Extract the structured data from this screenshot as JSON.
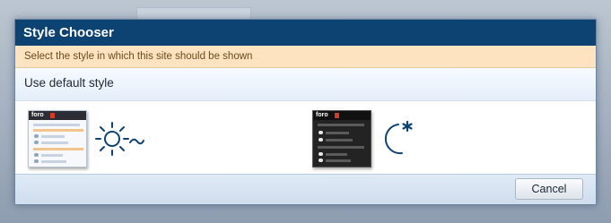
{
  "dialog": {
    "title": "Style Chooser",
    "explain": "Select the style in which this site should be shown",
    "default_style_label": "Use default style",
    "cancel_label": "Cancel"
  },
  "styles": [
    {
      "name": "light",
      "thumbnail_logo": "foro",
      "icon": "sun-icon"
    },
    {
      "name": "dark",
      "thumbnail_logo": "foro",
      "icon": "moon-icon"
    }
  ],
  "colors": {
    "title_bar": "#0d4373",
    "explain_bg": "#fde3bf",
    "footer_bg": "#dfeaf6",
    "icon": "#0d4373"
  }
}
